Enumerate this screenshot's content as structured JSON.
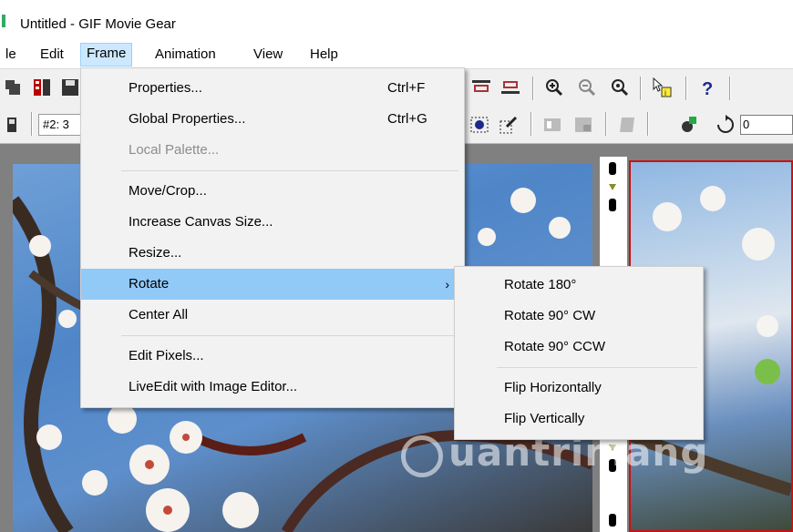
{
  "window": {
    "title": "Untitled - GIF Movie Gear"
  },
  "menubar": {
    "items": [
      "le",
      "Edit",
      "Frame",
      "Animation",
      "View",
      "Help"
    ],
    "active": "Frame"
  },
  "toolbar": {
    "frame_indicator": "#2: 3",
    "number_input_value": "0",
    "icons": [
      "move-icon",
      "film-icon",
      "save-icon",
      "align-top-icon",
      "align-bottom-icon",
      "zoom-in-icon",
      "zoom-out-icon",
      "zoom-fit-icon",
      "select-icon",
      "help-icon",
      "frame-icon",
      "paint-icon",
      "tile-icon",
      "tile-2-icon",
      "tile-3-icon",
      "color-icon",
      "loop-icon"
    ]
  },
  "frame_menu": {
    "items": [
      {
        "label": "Properties...",
        "shortcut": "Ctrl+F",
        "enabled": true
      },
      {
        "label": "Global Properties...",
        "shortcut": "Ctrl+G",
        "enabled": true
      },
      {
        "label": "Local Palette...",
        "shortcut": "",
        "enabled": false
      },
      {
        "label": "Move/Crop...",
        "shortcut": "",
        "enabled": true
      },
      {
        "label": "Increase Canvas Size...",
        "shortcut": "",
        "enabled": true
      },
      {
        "label": "Resize...",
        "shortcut": "",
        "enabled": true
      },
      {
        "label": "Rotate",
        "shortcut": "",
        "enabled": true,
        "submenu": true,
        "highlighted": true
      },
      {
        "label": "Center All",
        "shortcut": "",
        "enabled": true
      },
      {
        "label": "Edit Pixels...",
        "shortcut": "",
        "enabled": true
      },
      {
        "label": "LiveEdit with Image Editor...",
        "shortcut": "",
        "enabled": true
      }
    ],
    "submenu_arrow": "›"
  },
  "rotate_menu": {
    "items": [
      {
        "label": "Rotate 180°"
      },
      {
        "label": "Rotate 90° CW"
      },
      {
        "label": "Rotate 90° CCW"
      },
      {
        "label": "Flip Horizontally"
      },
      {
        "label": "Flip Vertically"
      }
    ]
  },
  "colors": {
    "menu_highlight": "#91c9f7",
    "menubar_active": "#cce8ff",
    "frame_selected_border": "#cc1111"
  },
  "watermark": "uantrimang"
}
